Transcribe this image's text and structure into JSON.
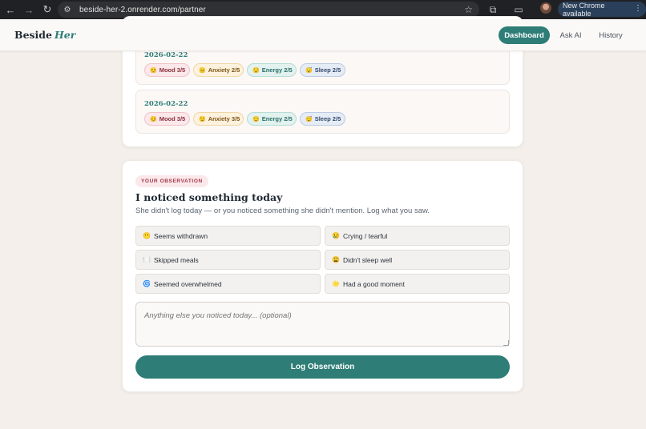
{
  "browser": {
    "url": "beside-her-2.onrender.com/partner",
    "update_label": "New Chrome available"
  },
  "header": {
    "logo_main": "Beside",
    "logo_accent": "Her",
    "nav": [
      {
        "label": "Dashboard",
        "active": true
      },
      {
        "label": "Ask AI",
        "active": false
      },
      {
        "label": "History",
        "active": false
      }
    ]
  },
  "history": {
    "entries": [
      {
        "date": "2026-02-22",
        "pills": [
          {
            "icon": "😊",
            "label": "Mood 3/5"
          },
          {
            "icon": "😐",
            "label": "Anxiety 2/5"
          },
          {
            "icon": "😌",
            "label": "Energy 2/5"
          },
          {
            "icon": "😴",
            "label": "Sleep 2/5"
          }
        ]
      },
      {
        "date": "2026-02-22",
        "pills": [
          {
            "icon": "😊",
            "label": "Mood 3/5"
          },
          {
            "icon": "😟",
            "label": "Anxiety 3/5"
          },
          {
            "icon": "😌",
            "label": "Energy 2/5"
          },
          {
            "icon": "😴",
            "label": "Sleep 2/5"
          }
        ]
      }
    ]
  },
  "observation": {
    "tag": "YOUR OBSERVATION",
    "title": "I noticed something today",
    "subtitle": "She didn't log today — or you noticed something she didn't mention. Log what you saw.",
    "options": [
      {
        "icon": "😶",
        "label": "Seems withdrawn"
      },
      {
        "icon": "😢",
        "label": "Crying / tearful"
      },
      {
        "icon": "🍽️",
        "label": "Skipped meals"
      },
      {
        "icon": "😩",
        "label": "Didn't sleep well"
      },
      {
        "icon": "🌀",
        "label": "Seemed overwhelmed"
      },
      {
        "icon": "🌟",
        "label": "Had a good moment"
      }
    ],
    "notes_placeholder": "Anything else you noticed today... (optional)",
    "submit_label": "Log Observation"
  },
  "colors": {
    "accent": "#2e7d77",
    "background": "#f4efeb"
  }
}
